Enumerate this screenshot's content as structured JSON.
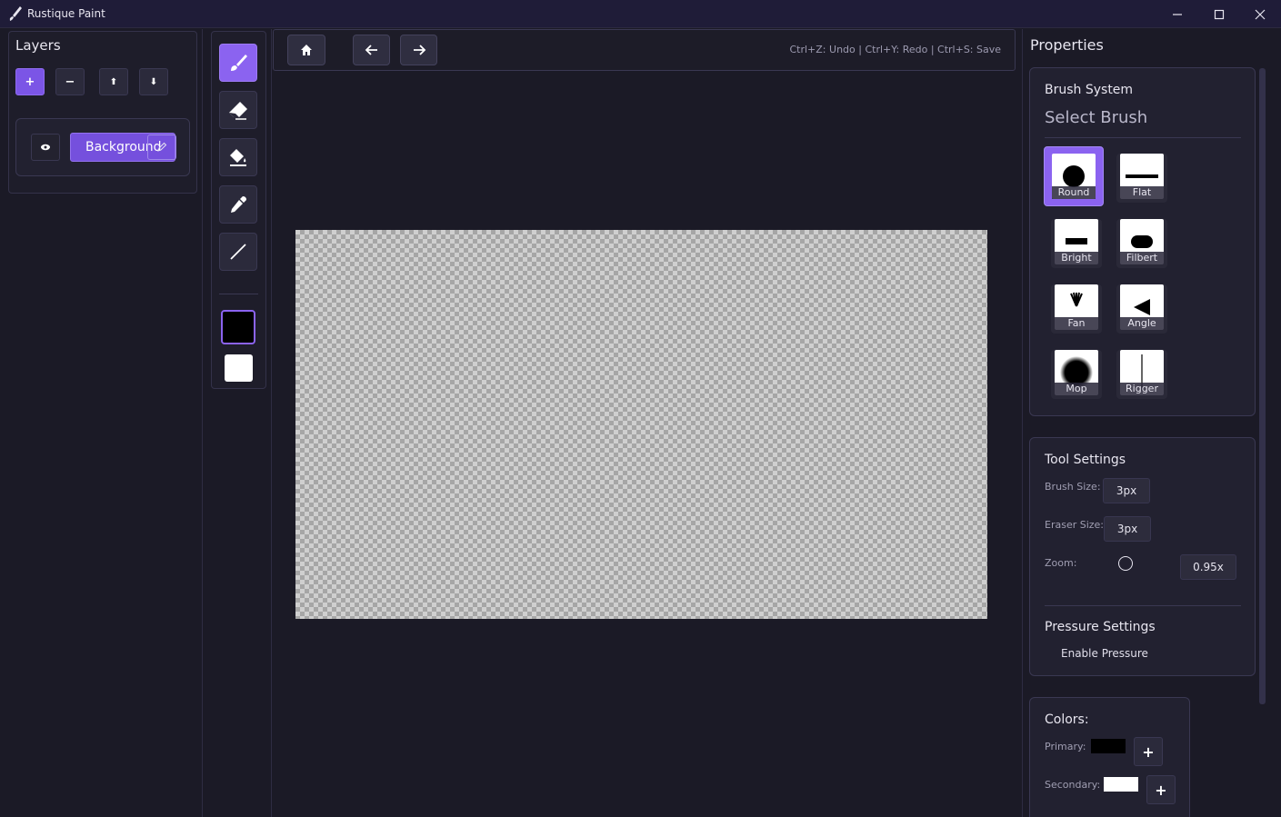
{
  "window": {
    "title": "Rustique Paint",
    "controls": {
      "minimize": "—",
      "maximize": "☐",
      "close": "✕"
    }
  },
  "layers": {
    "heading": "Layers",
    "buttons": {
      "add": "+",
      "remove": "−",
      "up": "⬆",
      "down": "⬇"
    },
    "items": [
      {
        "name": "Background",
        "visible_icon": "eye-icon"
      }
    ]
  },
  "tools": {
    "items": [
      "brush-tool",
      "eraser-tool",
      "fill-tool",
      "eyedropper-tool",
      "line-tool"
    ],
    "active": "brush-tool",
    "primary_color": "#000000",
    "secondary_color": "#ffffff"
  },
  "navbar": {
    "shortcuts": "Ctrl+Z: Undo | Ctrl+Y: Redo | Ctrl+S: Save"
  },
  "properties": {
    "heading": "Properties",
    "brush_system": {
      "title": "Brush System",
      "subtitle": "Select Brush",
      "brushes": [
        {
          "label": "Round",
          "active": true
        },
        {
          "label": "Flat",
          "active": false
        },
        {
          "label": "Bright",
          "active": false
        },
        {
          "label": "Filbert",
          "active": false
        },
        {
          "label": "Fan",
          "active": false
        },
        {
          "label": "Angle",
          "active": false
        },
        {
          "label": "Mop",
          "active": false
        },
        {
          "label": "Rigger",
          "active": false
        }
      ]
    },
    "tool_settings": {
      "title": "Tool Settings",
      "brush_size_label": "Brush Size:",
      "brush_size": "3px",
      "eraser_size_label": "Eraser Size:",
      "eraser_size": "3px",
      "zoom_label": "Zoom:",
      "zoom": "0.95x"
    },
    "pressure": {
      "title": "Pressure Settings",
      "enable_label": "Enable Pressure"
    },
    "colors": {
      "title": "Colors:",
      "primary_label": "Primary:",
      "secondary_label": "Secondary:",
      "add": "+"
    }
  },
  "theme": {
    "accent": "#8b63f0",
    "background": "#1b1a26"
  }
}
